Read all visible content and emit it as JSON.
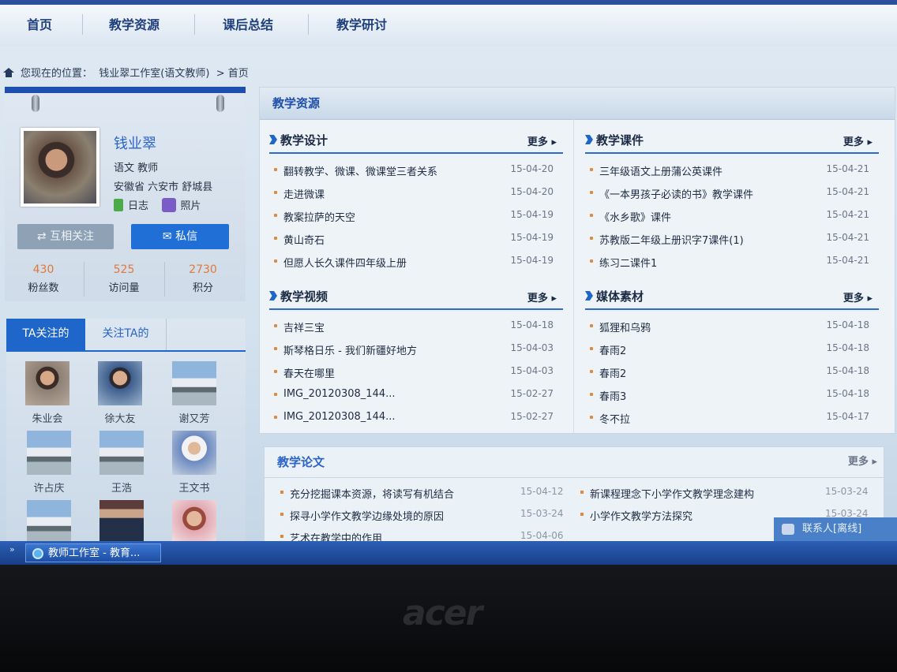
{
  "nav": {
    "items": [
      "首页",
      "教学资源",
      "课后总结",
      "教学研讨"
    ]
  },
  "breadcrumb": {
    "prefix": "您现在的位置：",
    "studio": "钱业翠工作室(语文教师)",
    "sep": ">",
    "current": "首页"
  },
  "profile": {
    "name": "钱业翠",
    "subject": "语文 教师",
    "location": "安徽省 六安市 舒城县",
    "diary": "日志",
    "photos": "照片",
    "follow_btn": "互相关注",
    "msg_btn": "私信",
    "stats": [
      {
        "n": "430",
        "l": "粉丝数"
      },
      {
        "n": "525",
        "l": "访问量"
      },
      {
        "n": "2730",
        "l": "积分"
      }
    ]
  },
  "follow": {
    "tab_active": "TA关注的",
    "tab_other": "关注TA的",
    "people": [
      "朱业会",
      "徐大友",
      "谢又芳",
      "许占庆",
      "王浩",
      "王文书"
    ]
  },
  "main": {
    "title": "教学资源",
    "more": "更多",
    "sections": [
      {
        "title": "教学设计",
        "rows": [
          {
            "t": "翻转教学、微课、微课堂三者关系",
            "d": "15-04-20"
          },
          {
            "t": "走进微课",
            "d": "15-04-20"
          },
          {
            "t": "教案拉萨的天空",
            "d": "15-04-19"
          },
          {
            "t": "黄山奇石",
            "d": "15-04-19"
          },
          {
            "t": "但愿人长久课件四年级上册",
            "d": "15-04-19"
          }
        ]
      },
      {
        "title": "教学课件",
        "rows": [
          {
            "t": "三年级语文上册蒲公英课件",
            "d": "15-04-21"
          },
          {
            "t": "《一本男孩子必读的书》教学课件",
            "d": "15-04-21"
          },
          {
            "t": "《水乡歌》课件",
            "d": "15-04-21"
          },
          {
            "t": "苏教版二年级上册识字7课件(1)",
            "d": "15-04-21"
          },
          {
            "t": "练习二课件1",
            "d": "15-04-21"
          }
        ]
      },
      {
        "title": "教学视频",
        "rows": [
          {
            "t": "吉祥三宝",
            "d": "15-04-18"
          },
          {
            "t": "斯琴格日乐 - 我们新疆好地方",
            "d": "15-04-03"
          },
          {
            "t": "春天在哪里",
            "d": "15-04-03"
          },
          {
            "t": "IMG_20120308_144...",
            "d": "15-02-27"
          },
          {
            "t": "IMG_20120308_144...",
            "d": "15-02-27"
          }
        ]
      },
      {
        "title": "媒体素材",
        "rows": [
          {
            "t": "狐狸和乌鸦",
            "d": "15-04-18"
          },
          {
            "t": "春雨2",
            "d": "15-04-18"
          },
          {
            "t": "春雨2",
            "d": "15-04-18"
          },
          {
            "t": "春雨3",
            "d": "15-04-18"
          },
          {
            "t": "冬不拉",
            "d": "15-04-17"
          }
        ]
      }
    ]
  },
  "papers": {
    "title": "教学论文",
    "more": "更多",
    "left": [
      {
        "t": "充分挖掘课本资源，将读写有机结合",
        "d": "15-04-12"
      },
      {
        "t": "探寻小学作文教学边缘处境的原因",
        "d": "15-03-24"
      },
      {
        "t": "艺术在教学中的作用",
        "d": "15-04-06"
      }
    ],
    "right": [
      {
        "t": "新课程理念下小学作文教学理念建构",
        "d": "15-03-24"
      },
      {
        "t": "小学作文教学方法探究",
        "d": "15-03-24"
      }
    ]
  },
  "contact": "联系人[离线]",
  "taskbar": {
    "chev": "»",
    "task": "教师工作室 - 教育..."
  },
  "brand": "acer"
}
